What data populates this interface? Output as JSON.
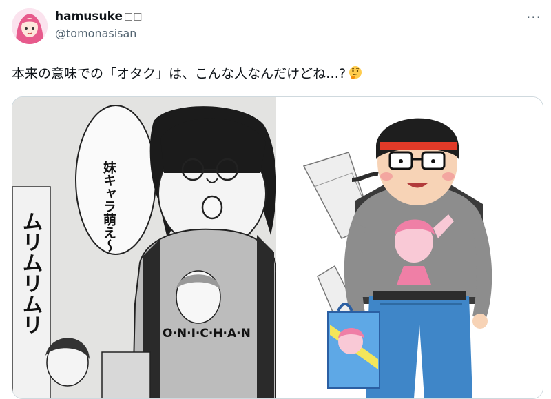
{
  "author": {
    "display_name": "hamusuke",
    "name_suffix": "□□",
    "handle": "@tomonasisan"
  },
  "menu": {
    "more_label": "···",
    "more_icon": "more-options-icon"
  },
  "tweet": {
    "text": "本来の意味での「オタク」は、こんな人なんだけどね…?",
    "emoji": "thinking-face-icon"
  },
  "media": {
    "left_image": {
      "speech_bubble": "妹キャラ萌え〜",
      "side_text": "ムリムリムリ",
      "shirt_text": "O·N·I·C·H·A·N"
    },
    "right_image": {
      "type": "illustration"
    }
  },
  "colors": {
    "text": "#0f1419",
    "secondary": "#536471",
    "border": "#cfd9de"
  }
}
